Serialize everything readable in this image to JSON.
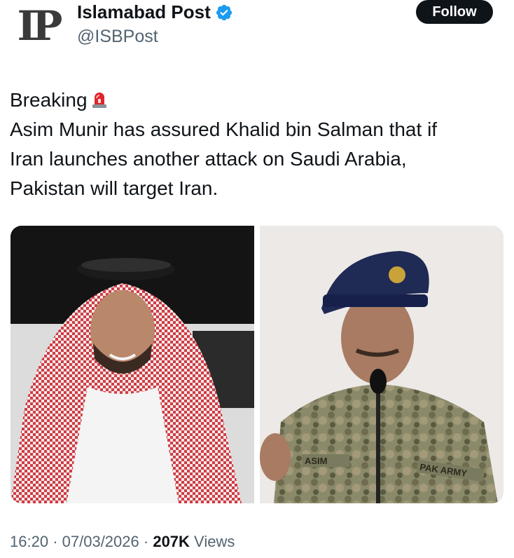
{
  "header": {
    "avatar_text": "IP",
    "display_name": "Islamabad Post",
    "handle": "@ISBPost",
    "follow_label": "Follow",
    "verified_icon": "verified-badge-icon"
  },
  "tweet": {
    "lines": [
      "Breaking",
      "Asim Munir has assured Khalid bin Salman that if",
      "Iran launches another attack on Saudi Arabia,",
      "Pakistan will target Iran."
    ],
    "emoji_icon": "siren-icon"
  },
  "media": {
    "left_photo_desc_icon": "photo-icon",
    "right_photo_desc_icon": "photo-icon",
    "name_tape": "ASIM",
    "unit_tape": "PAK ARMY"
  },
  "meta": {
    "time": "16:20",
    "date": "07/03/2026",
    "views_count": "207K",
    "views_label": "Views"
  },
  "colors": {
    "follow_bg": "#0f1419",
    "verified": "#1d9bf0",
    "muted_text": "#536471"
  }
}
